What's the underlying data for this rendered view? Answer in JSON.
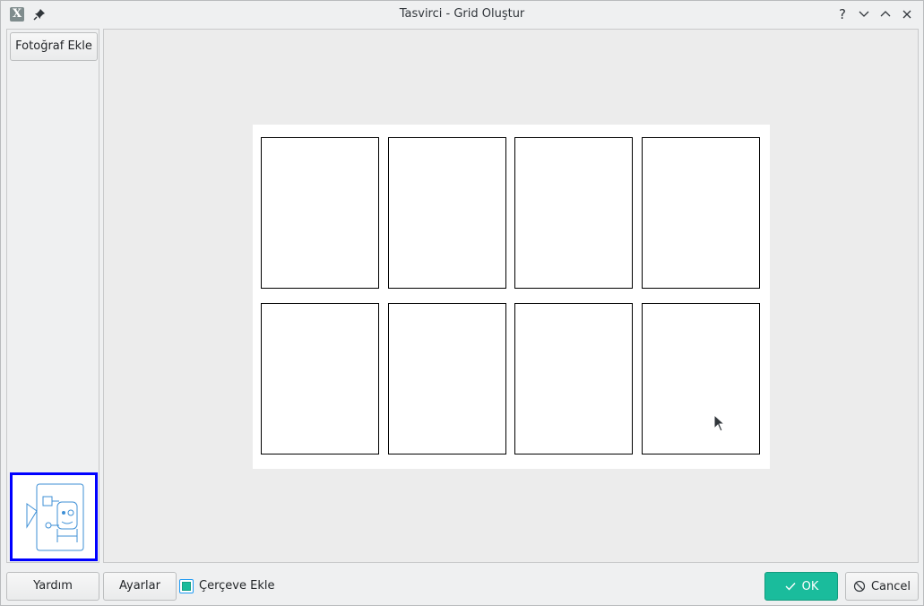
{
  "window": {
    "title": "Tasvirci - Grid Oluştur",
    "app_icon_glyph": "X",
    "help_glyph": "?"
  },
  "left_panel": {
    "add_photo_label": "Fotoğraf Ekle"
  },
  "canvas": {
    "grid_rows": 2,
    "grid_columns": 4
  },
  "bottom_bar": {
    "help_label": "Yardım",
    "settings_label": "Ayarlar",
    "frame_checkbox_label": "Çerçeve Ekle",
    "frame_checked": true,
    "ok_label": "OK",
    "cancel_label": "Cancel"
  },
  "colors": {
    "accent": "#1abc9c",
    "thumbnail_border": "#0000ff",
    "thumbnail_line": "#3d8fd6"
  },
  "icons": [
    "app-icon",
    "pin-icon",
    "help-icon",
    "minimize-icon",
    "maximize-icon",
    "close-icon",
    "check-icon",
    "cancel-icon",
    "cursor-icon"
  ]
}
